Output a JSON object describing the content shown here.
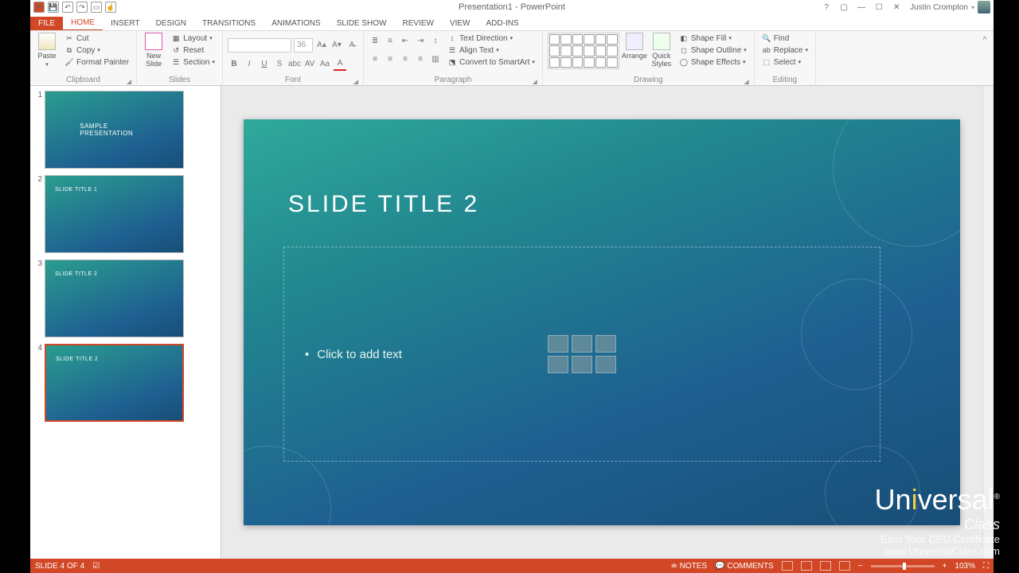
{
  "title": "Presentation1 - PowerPoint",
  "user": "Justin Crompton",
  "tabs": [
    "FILE",
    "HOME",
    "INSERT",
    "DESIGN",
    "TRANSITIONS",
    "ANIMATIONS",
    "SLIDE SHOW",
    "REVIEW",
    "VIEW",
    "ADD-INS"
  ],
  "clipboard": {
    "paste": "Paste",
    "cut": "Cut",
    "copy": "Copy",
    "fp": "Format Painter",
    "label": "Clipboard"
  },
  "slides_grp": {
    "new": "New\nSlide",
    "layout": "Layout",
    "reset": "Reset",
    "section": "Section",
    "label": "Slides"
  },
  "font_grp": {
    "size": "36",
    "label": "Font"
  },
  "para_grp": {
    "textdir": "Text Direction",
    "align": "Align Text",
    "convert": "Convert to SmartArt",
    "label": "Paragraph"
  },
  "draw_grp": {
    "arrange": "Arrange",
    "quick": "Quick\nStyles",
    "fill": "Shape Fill",
    "outline": "Shape Outline",
    "effects": "Shape Effects",
    "label": "Drawing"
  },
  "edit_grp": {
    "find": "Find",
    "replace": "Replace",
    "select": "Select",
    "label": "Editing"
  },
  "thumbs": [
    {
      "n": "1",
      "title": "SAMPLE PRESENTATION",
      "cls": "t1"
    },
    {
      "n": "2",
      "title": "SLIDE TITLE 1",
      "cls": ""
    },
    {
      "n": "3",
      "title": "SLIDE TITLE 2",
      "cls": ""
    },
    {
      "n": "4",
      "title": "SLIDE TITLE 2",
      "cls": "sel"
    }
  ],
  "editor": {
    "title": "SLIDE TITLE 2",
    "placeholder": "Click to add text"
  },
  "status": {
    "slide": "SLIDE 4 OF 4",
    "notes": "NOTES",
    "comments": "COMMENTS",
    "zoom": "103%"
  },
  "watermark": {
    "brand1": "Un",
    "brand2": "versal",
    "sub": "Class",
    "line1": "Earn Your CEU Certificate",
    "line2": "www.UniversalClass.com"
  }
}
